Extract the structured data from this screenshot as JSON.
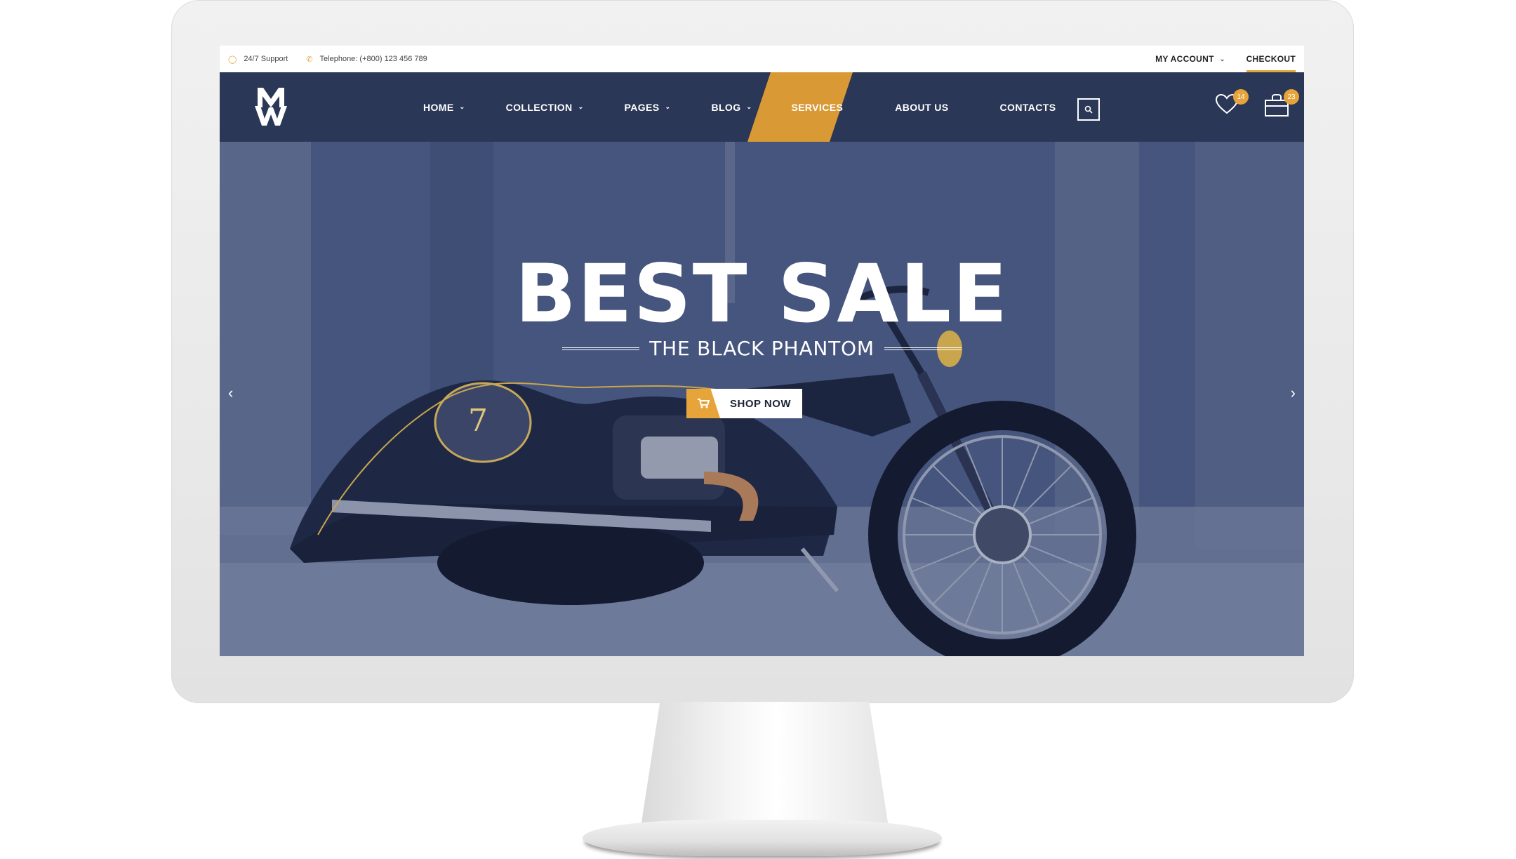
{
  "topbar": {
    "support": "24/7 Support",
    "telephone": "Telephone: (+800) 123 456 789",
    "my_account": "MY ACCOUNT",
    "checkout": "CHECKOUT"
  },
  "nav": {
    "items": [
      {
        "label": "HOME",
        "has_dropdown": true
      },
      {
        "label": "COLLECTION",
        "has_dropdown": true
      },
      {
        "label": "PAGES",
        "has_dropdown": true
      },
      {
        "label": "BLOG",
        "has_dropdown": true
      },
      {
        "label": "SERVICES",
        "has_dropdown": false,
        "active": true
      },
      {
        "label": "ABOUT US",
        "has_dropdown": false
      },
      {
        "label": "CONTACTS",
        "has_dropdown": false
      }
    ],
    "wishlist_count": "14",
    "cart_count": "23"
  },
  "hero": {
    "title": "BEST SALE",
    "subtitle": "THE BLACK PHANTOM",
    "button_label": "SHOP NOW",
    "tank_badge": "7"
  },
  "colors": {
    "accent": "#e3a63a",
    "nav_bg": "#2b3756",
    "hero_tint": "#3e4c70"
  }
}
